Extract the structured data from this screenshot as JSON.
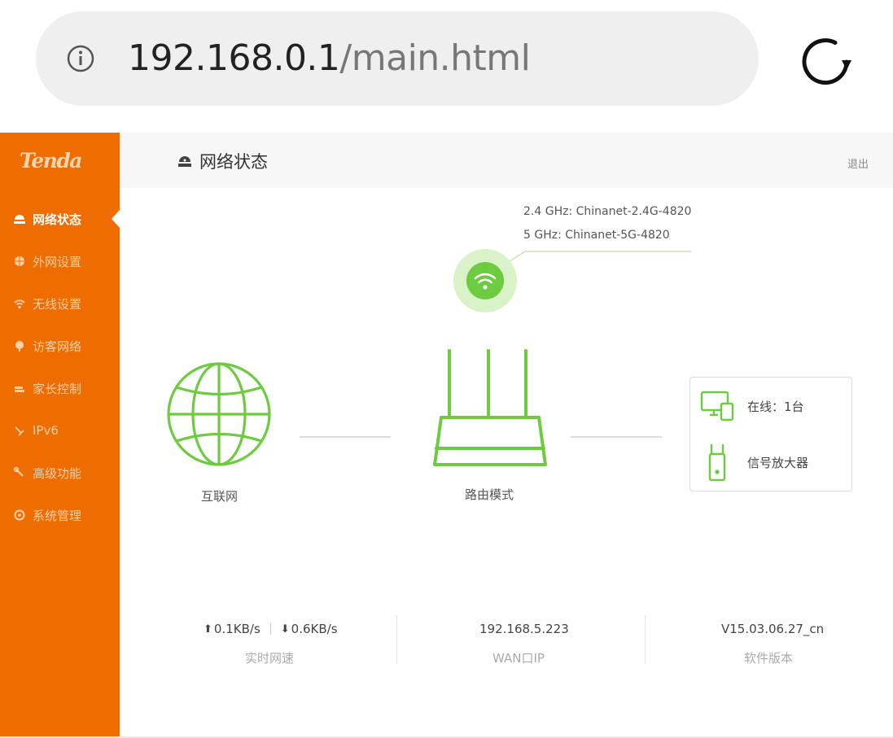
{
  "browser": {
    "url_host": "192.168.0.1",
    "url_path": "/main.html",
    "icons": {
      "info": "info-icon",
      "reload": "reload-icon"
    }
  },
  "sidebar": {
    "logo": "Tenda",
    "items": [
      {
        "label": "网络状态",
        "icon": "network-status-icon",
        "active": true
      },
      {
        "label": "外网设置",
        "icon": "globe-icon",
        "active": false
      },
      {
        "label": "无线设置",
        "icon": "wifi-icon",
        "active": false
      },
      {
        "label": "访客网络",
        "icon": "guest-icon",
        "active": false
      },
      {
        "label": "家长控制",
        "icon": "parental-icon",
        "active": false
      },
      {
        "label": "IPv6",
        "icon": "ipv6-icon",
        "active": false
      },
      {
        "label": "高级功能",
        "icon": "wrench-icon",
        "active": false
      },
      {
        "label": "系统管理",
        "icon": "gear-icon",
        "active": false
      }
    ]
  },
  "header": {
    "title": "网络状态",
    "logout": "退出"
  },
  "topology": {
    "ssid_24": "2.4 GHz: Chinanet-2.4G-4820",
    "ssid_5": "5 GHz: Chinanet-5G-4820",
    "internet_label": "互联网",
    "router_label": "路由模式",
    "devices": {
      "online": "在线：1台",
      "extender": "信号放大器"
    }
  },
  "stats": {
    "upload": "0.1KB/s",
    "download": "0.6KB/s",
    "speed_label": "实时网速",
    "wan_ip": "192.168.5.223",
    "wan_label": "WAN口IP",
    "version": "V15.03.06.27_cn",
    "version_label": "软件版本"
  },
  "colors": {
    "accent": "#ef6c00",
    "green": "#6ccb3f",
    "green_halo": "#d9f2c8"
  }
}
